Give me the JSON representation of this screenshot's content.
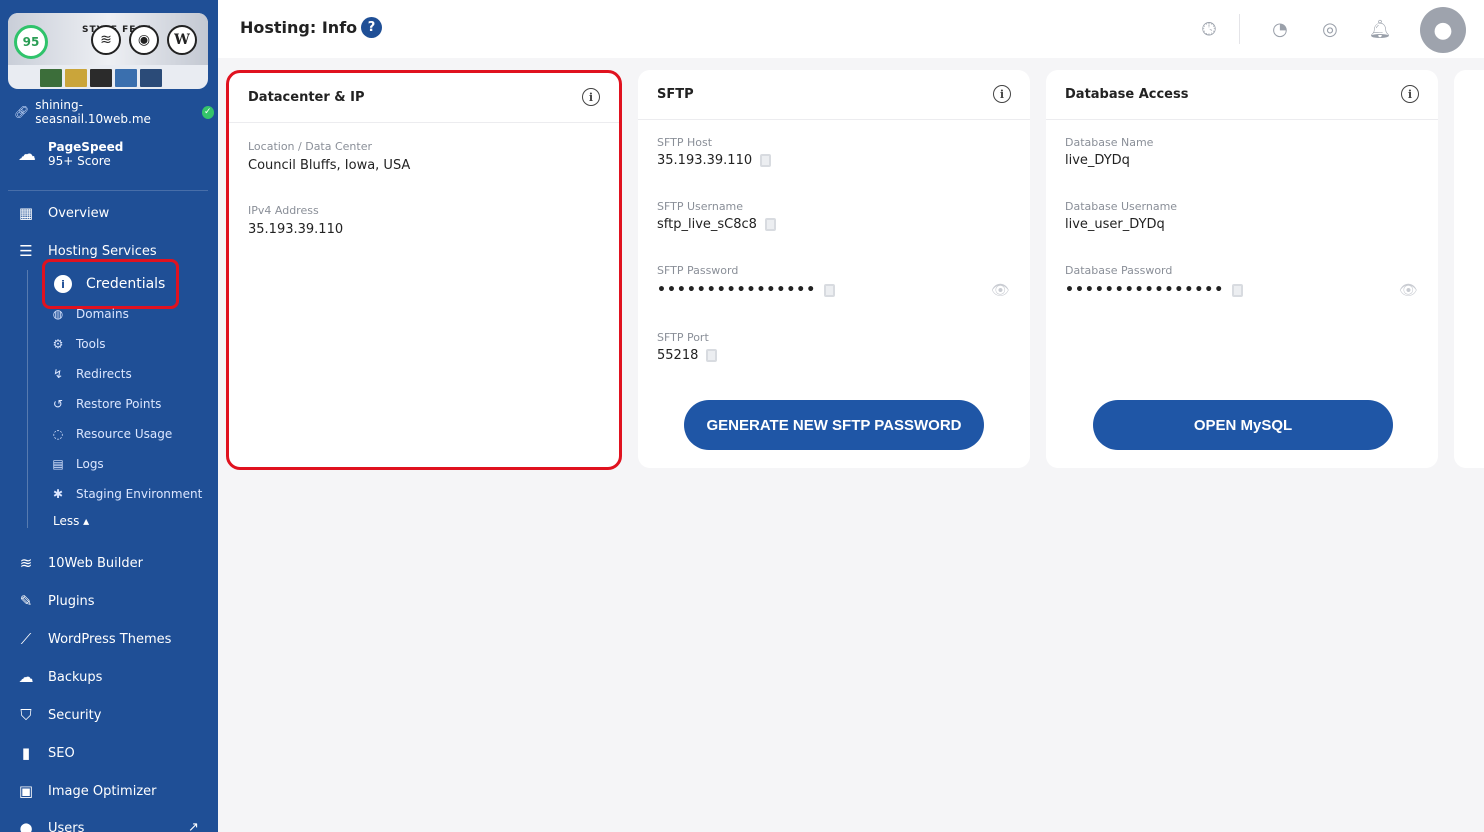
{
  "sidebar": {
    "thumb": {
      "score": "95",
      "banner_text": "STYLE FEAT"
    },
    "site_url": "shining-seasnail.10web.me",
    "pagespeed": {
      "title": "PageSpeed",
      "score": "95+ Score"
    },
    "nav": {
      "overview": "Overview",
      "hosting_services": "Hosting Services",
      "credentials": "Credentials",
      "domains": "Domains",
      "tools": "Tools",
      "redirects": "Redirects",
      "restore_points": "Restore Points",
      "resource_usage": "Resource Usage",
      "logs": "Logs",
      "staging": "Staging Environment",
      "less": "Less ▴",
      "builder": "10Web Builder",
      "plugins": "Plugins",
      "themes": "WordPress Themes",
      "backups": "Backups",
      "security": "Security",
      "seo": "SEO",
      "image_optimizer": "Image Optimizer",
      "users": "Users"
    }
  },
  "header": {
    "title": "Hosting: Info",
    "help": "?"
  },
  "datacenter": {
    "title": "Datacenter & IP",
    "location_label": "Location / Data Center",
    "location_value": "Council Bluffs, Iowa, USA",
    "ipv4_label": "IPv4 Address",
    "ipv4_value": "35.193.39.110"
  },
  "sftp": {
    "title": "SFTP",
    "host_label": "SFTP Host",
    "host_value": "35.193.39.110",
    "username_label": "SFTP Username",
    "username_value": "sftp_live_sC8c8",
    "password_label": "SFTP Password",
    "password_value": "••••••••••••••••",
    "port_label": "SFTP Port",
    "port_value": "55218",
    "button": "GENERATE NEW SFTP PASSWORD"
  },
  "database": {
    "title": "Database Access",
    "name_label": "Database Name",
    "name_value": "live_DYDq",
    "username_label": "Database Username",
    "username_value": "live_user_DYDq",
    "password_label": "Database Password",
    "password_value": "••••••••••••••••",
    "button": "OPEN MySQL"
  },
  "colors": {
    "sidebar": "#1f4f96",
    "highlight": "#e0121f",
    "button": "#1f56a6",
    "success": "#35c46a"
  }
}
